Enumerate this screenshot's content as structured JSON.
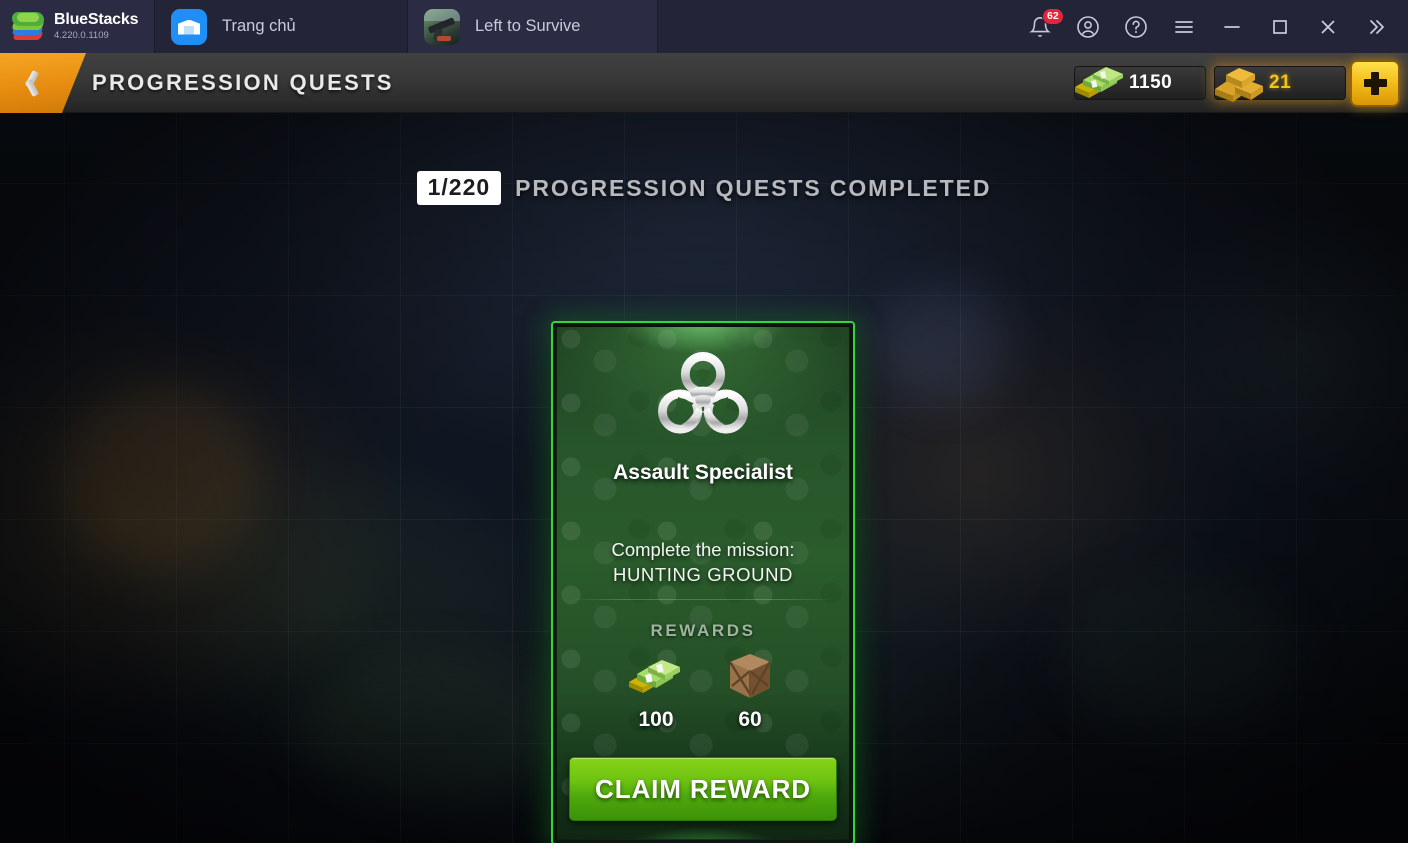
{
  "bluestacks": {
    "brand_name": "BlueStacks",
    "version": "4.220.0.1109",
    "tabs": [
      {
        "label": "Trang chủ",
        "icon": "home-icon",
        "active": false
      },
      {
        "label": "Left to Survive",
        "icon": "game-thumbnail-icon",
        "active": true
      }
    ],
    "actions": [
      {
        "name": "notifications-icon",
        "badge": "62"
      },
      {
        "name": "account-icon"
      },
      {
        "name": "help-icon"
      },
      {
        "name": "menu-icon"
      },
      {
        "name": "minimize-icon"
      },
      {
        "name": "maximize-icon"
      },
      {
        "name": "close-icon"
      },
      {
        "name": "expand-more-icon"
      }
    ]
  },
  "game_header": {
    "back_label": "back",
    "title": "PROGRESSION QUESTS",
    "currencies": [
      {
        "name": "cash",
        "value": "1150",
        "icon": "cash-stack-icon",
        "color": "#ffffff"
      },
      {
        "name": "gold",
        "value": "21",
        "icon": "gold-bars-icon",
        "color": "#f5c219"
      }
    ],
    "add_button_label": "+"
  },
  "progress": {
    "counter": "1/220",
    "label": "PROGRESSION QUESTS COMPLETED"
  },
  "quest_card": {
    "icon": "biohazard-icon",
    "title": "Assault Specialist",
    "objective_line1": "Complete the mission:",
    "objective_line2": "HUNTING GROUND",
    "rewards_label": "REWARDS",
    "rewards": [
      {
        "icon": "cash-stack-icon",
        "value": "100"
      },
      {
        "icon": "wooden-crate-icon",
        "value": "60"
      }
    ],
    "claim_label": "CLAIM REWARD",
    "accent_color": "#35d43a",
    "button_color": "#6dc211"
  }
}
